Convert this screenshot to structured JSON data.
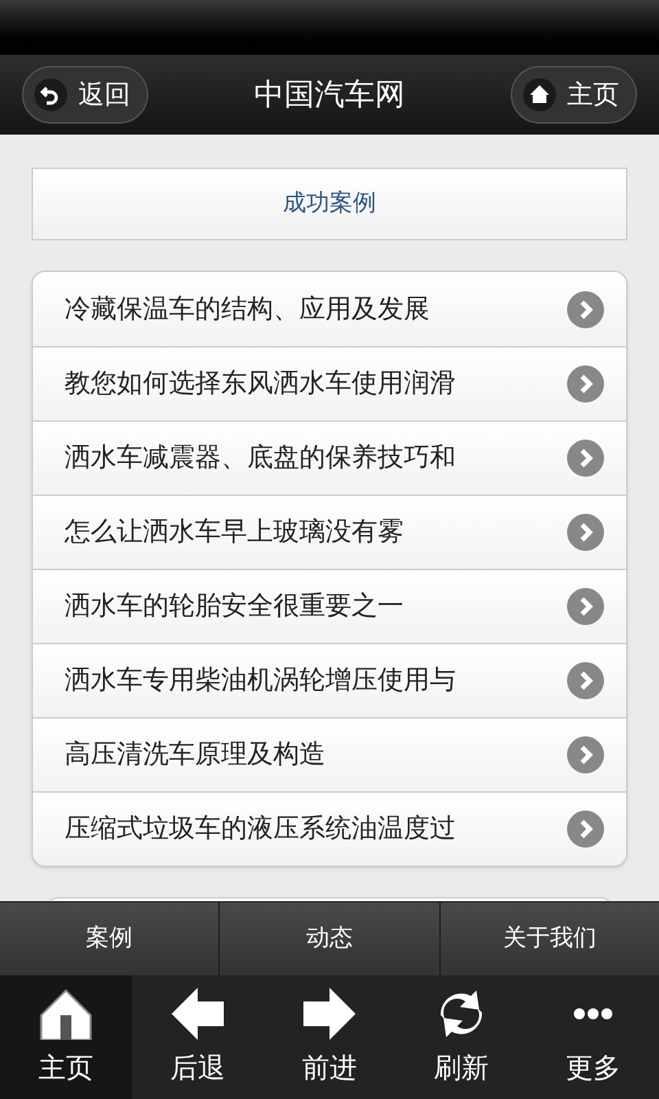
{
  "header": {
    "back_button": "返回",
    "title": "中国汽车网",
    "home_button": "主页"
  },
  "section": {
    "title": "成功案例"
  },
  "articles": [
    {
      "title": "冷藏保温车的结构、应用及发展"
    },
    {
      "title": "教您如何选择东风洒水车使用润滑"
    },
    {
      "title": "洒水车减震器、底盘的保养技巧和"
    },
    {
      "title": "怎么让洒水车早上玻璃没有雾"
    },
    {
      "title": "洒水车的轮胎安全很重要之一"
    },
    {
      "title": "洒水车专用柴油机涡轮增压使用与"
    },
    {
      "title": "高压清洗车原理及构造"
    },
    {
      "title": "压缩式垃圾车的液压系统油温度过"
    }
  ],
  "tabs": [
    {
      "label": "案例"
    },
    {
      "label": "动态"
    },
    {
      "label": "关于我们"
    }
  ],
  "nav": [
    {
      "kind": "home",
      "label": "主页",
      "selected": true
    },
    {
      "kind": "back",
      "label": "后退",
      "selected": false
    },
    {
      "kind": "forward",
      "label": "前进",
      "selected": false
    },
    {
      "kind": "refresh",
      "label": "刷新",
      "selected": false
    },
    {
      "kind": "more",
      "label": "更多",
      "selected": false
    }
  ]
}
